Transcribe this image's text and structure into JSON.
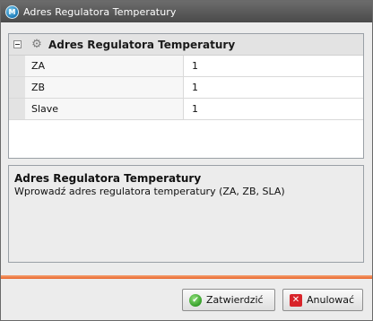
{
  "window": {
    "title": "Adres Regulatora Temperatury",
    "icon": "app-logo-icon"
  },
  "grid": {
    "category": {
      "title": "Adres Regulatora Temperatury",
      "icon": "gear-icon",
      "expanded": true
    },
    "rows": [
      {
        "name": "ZA",
        "value": "1"
      },
      {
        "name": "ZB",
        "value": "1"
      },
      {
        "name": "Slave",
        "value": "1"
      }
    ]
  },
  "help": {
    "title": "Adres Regulatora Temperatury",
    "description": "Wprowadź adres regulatora temperatury (ZA, ZB, SLA)"
  },
  "buttons": {
    "ok_label": "Zatwierdzić",
    "ok_icon": "check-icon",
    "cancel_label": "Anulować",
    "cancel_icon": "close-icon"
  },
  "colors": {
    "accent_bar": "#e8662e",
    "titlebar": "#5a5a5a"
  }
}
